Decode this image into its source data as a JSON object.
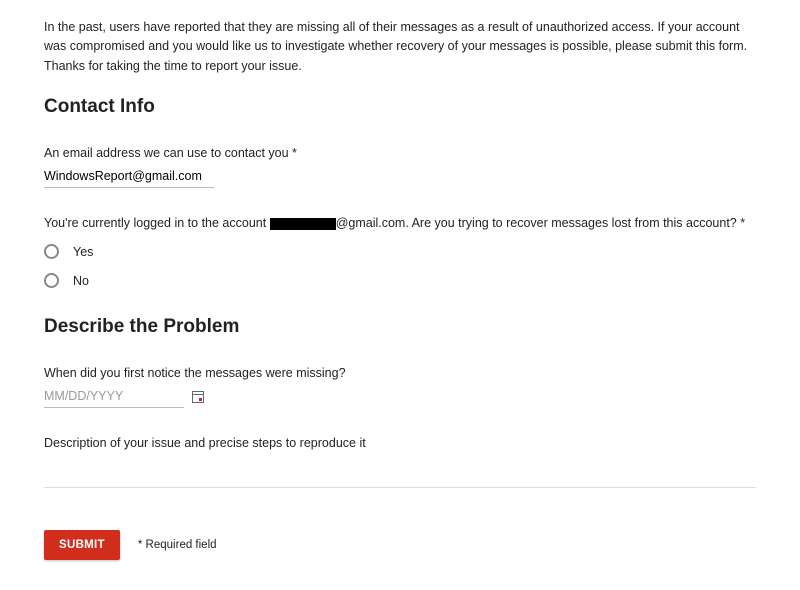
{
  "intro": "In the past, users have reported that they are missing all of their messages as a result of unauthorized access. If your account was compromised and you would like us to investigate whether recovery of your messages is possible, please submit this form. Thanks for taking the time to report your issue.",
  "sections": {
    "contact": {
      "heading": "Contact Info",
      "email_label": "An email address we can use to contact you *",
      "email_value": "WindowsReport@gmail.com",
      "account_question_prefix": "You're currently logged in to the account ",
      "account_domain": "@gmail.com",
      "account_question_suffix": ". Are you trying to recover messages lost from this account? *",
      "option_yes": "Yes",
      "option_no": "No"
    },
    "problem": {
      "heading": "Describe the Problem",
      "date_label": "When did you first notice the messages were missing?",
      "date_placeholder": "MM/DD/YYYY",
      "desc_label": "Description of your issue and precise steps to reproduce it"
    }
  },
  "footer": {
    "submit": "SUBMIT",
    "required_note": "* Required field"
  }
}
